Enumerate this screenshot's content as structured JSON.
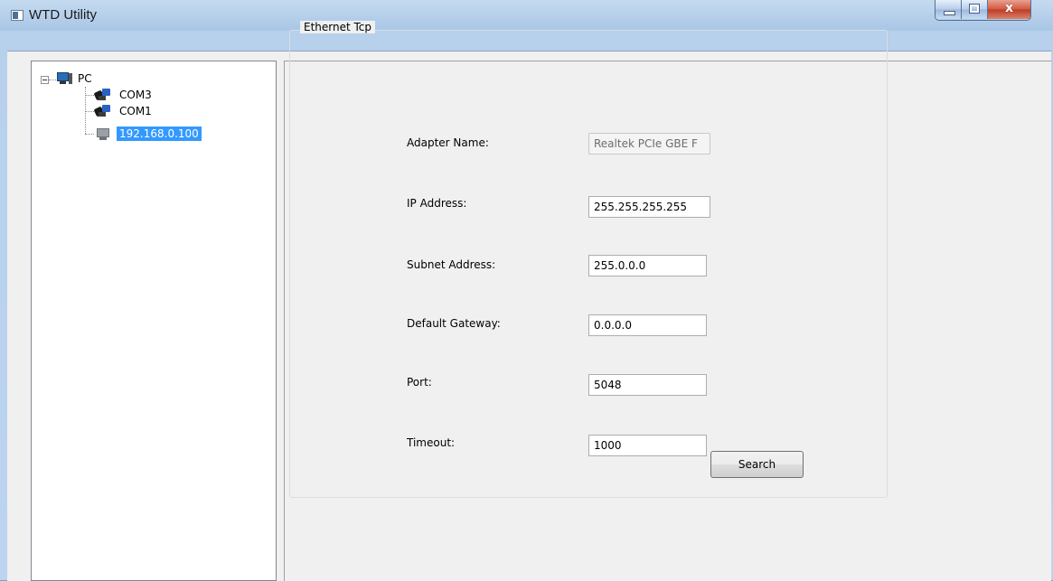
{
  "window": {
    "title": "WTD Utility"
  },
  "caption_buttons": {
    "close_glyph": "x"
  },
  "tree": {
    "root": "PC",
    "children": [
      "COM3",
      "COM1",
      "192.168.0.100"
    ],
    "selected": "192.168.0.100"
  },
  "panel": {
    "group_title": "Ethernet Tcp",
    "fields": [
      {
        "label": "Adapter Name:",
        "value": "Realtek PCIe GBE F"
      },
      {
        "label": "IP Address:",
        "value": "255.255.255.255"
      },
      {
        "label": "Subnet Address:",
        "value": "255.0.0.0"
      },
      {
        "label": "Default Gateway:",
        "value": "0.0.0.0"
      },
      {
        "label": "Port:",
        "value": "5048"
      },
      {
        "label": "Timeout:",
        "value": "1000"
      }
    ],
    "search_label": "Search"
  }
}
